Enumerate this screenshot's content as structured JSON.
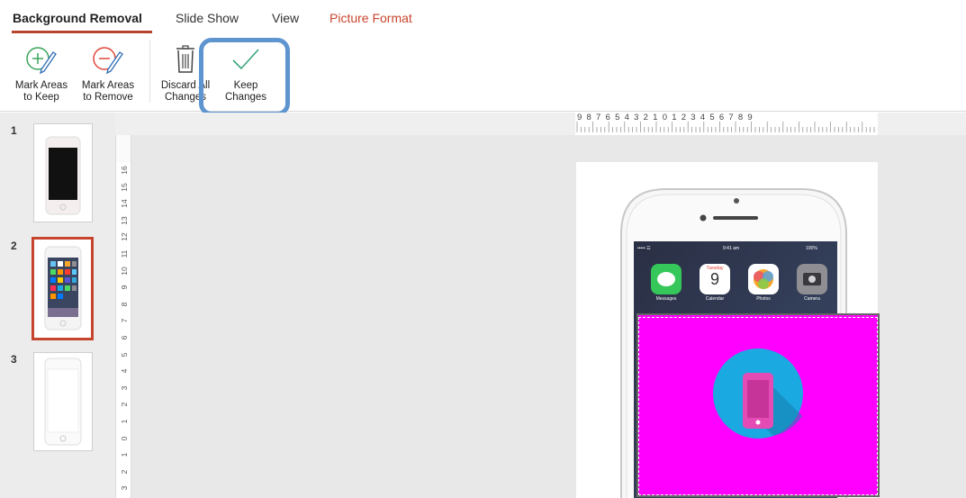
{
  "tabs": {
    "background_removal": "Background Removal",
    "slide_show": "Slide Show",
    "view": "View",
    "picture_format": "Picture Format"
  },
  "ribbon": {
    "mark_keep": {
      "line1": "Mark Areas",
      "line2": "to Keep"
    },
    "mark_remove": {
      "line1": "Mark Areas",
      "line2": "to Remove"
    },
    "discard": {
      "line1": "Discard All",
      "line2": "Changes"
    },
    "keep": {
      "line1": "Keep",
      "line2": "Changes"
    }
  },
  "slides": [
    {
      "number": "1"
    },
    {
      "number": "2",
      "selected": true
    },
    {
      "number": "3"
    }
  ],
  "ruler": {
    "horizontal_labels": "9 8 7 6 5 4 3 2 1 0 1 2 3 4 5 6 7 8 9",
    "vertical_labels": [
      "16",
      "15",
      "14",
      "13",
      "12",
      "11",
      "10",
      "9",
      "8",
      "7",
      "6",
      "5",
      "4",
      "3",
      "2",
      "1",
      "0",
      "1",
      "2",
      "3"
    ]
  },
  "phone_screen": {
    "carrier": "••••• ☲",
    "time": "9:41 am",
    "battery": "100%",
    "calendar_day": "Tuesday",
    "calendar_date": "9",
    "apps": [
      "Messages",
      "Calendar",
      "Photos",
      "Camera"
    ]
  },
  "colors": {
    "accent_red": "#c8452d",
    "highlight_blue": "#5f95cf",
    "removal_magenta": "#ff00ff",
    "icon_circle": "#1ba9e1",
    "icon_phone": "#e44bb5"
  }
}
